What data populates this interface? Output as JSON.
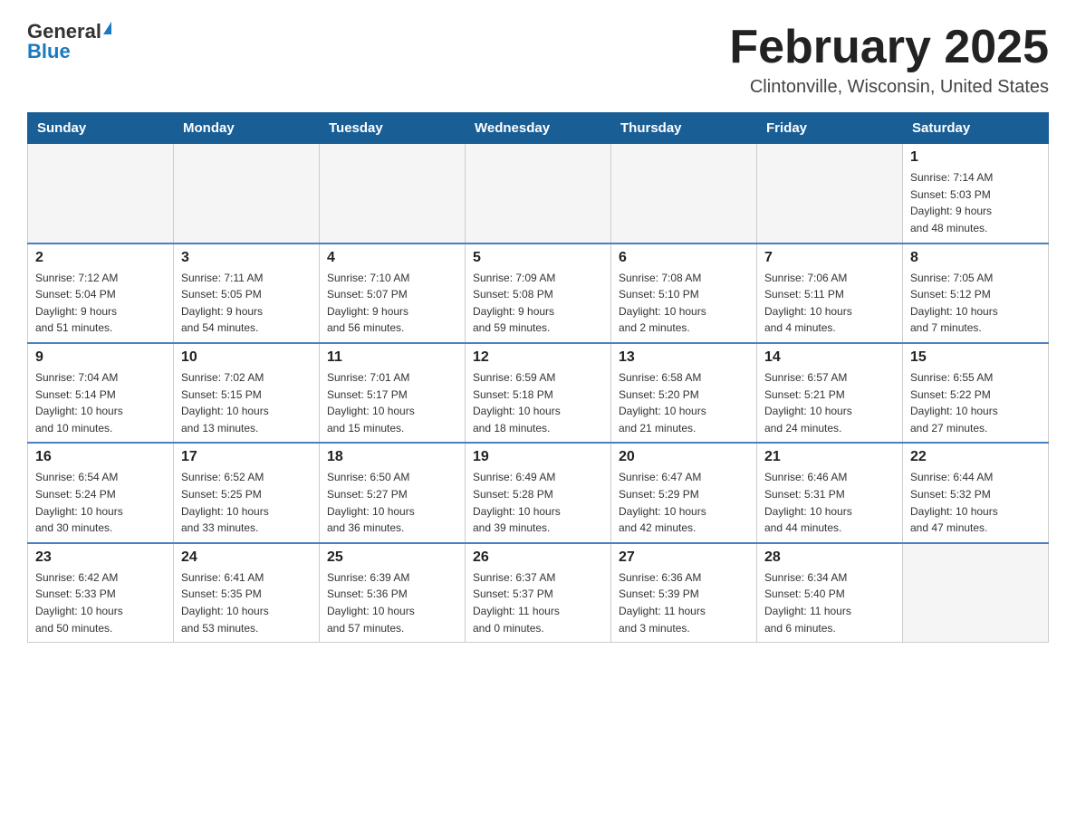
{
  "header": {
    "logo_general": "General",
    "logo_blue": "Blue",
    "title": "February 2025",
    "subtitle": "Clintonville, Wisconsin, United States"
  },
  "days_of_week": [
    "Sunday",
    "Monday",
    "Tuesday",
    "Wednesday",
    "Thursday",
    "Friday",
    "Saturday"
  ],
  "weeks": [
    [
      {
        "date": "",
        "info": ""
      },
      {
        "date": "",
        "info": ""
      },
      {
        "date": "",
        "info": ""
      },
      {
        "date": "",
        "info": ""
      },
      {
        "date": "",
        "info": ""
      },
      {
        "date": "",
        "info": ""
      },
      {
        "date": "1",
        "info": "Sunrise: 7:14 AM\nSunset: 5:03 PM\nDaylight: 9 hours\nand 48 minutes."
      }
    ],
    [
      {
        "date": "2",
        "info": "Sunrise: 7:12 AM\nSunset: 5:04 PM\nDaylight: 9 hours\nand 51 minutes."
      },
      {
        "date": "3",
        "info": "Sunrise: 7:11 AM\nSunset: 5:05 PM\nDaylight: 9 hours\nand 54 minutes."
      },
      {
        "date": "4",
        "info": "Sunrise: 7:10 AM\nSunset: 5:07 PM\nDaylight: 9 hours\nand 56 minutes."
      },
      {
        "date": "5",
        "info": "Sunrise: 7:09 AM\nSunset: 5:08 PM\nDaylight: 9 hours\nand 59 minutes."
      },
      {
        "date": "6",
        "info": "Sunrise: 7:08 AM\nSunset: 5:10 PM\nDaylight: 10 hours\nand 2 minutes."
      },
      {
        "date": "7",
        "info": "Sunrise: 7:06 AM\nSunset: 5:11 PM\nDaylight: 10 hours\nand 4 minutes."
      },
      {
        "date": "8",
        "info": "Sunrise: 7:05 AM\nSunset: 5:12 PM\nDaylight: 10 hours\nand 7 minutes."
      }
    ],
    [
      {
        "date": "9",
        "info": "Sunrise: 7:04 AM\nSunset: 5:14 PM\nDaylight: 10 hours\nand 10 minutes."
      },
      {
        "date": "10",
        "info": "Sunrise: 7:02 AM\nSunset: 5:15 PM\nDaylight: 10 hours\nand 13 minutes."
      },
      {
        "date": "11",
        "info": "Sunrise: 7:01 AM\nSunset: 5:17 PM\nDaylight: 10 hours\nand 15 minutes."
      },
      {
        "date": "12",
        "info": "Sunrise: 6:59 AM\nSunset: 5:18 PM\nDaylight: 10 hours\nand 18 minutes."
      },
      {
        "date": "13",
        "info": "Sunrise: 6:58 AM\nSunset: 5:20 PM\nDaylight: 10 hours\nand 21 minutes."
      },
      {
        "date": "14",
        "info": "Sunrise: 6:57 AM\nSunset: 5:21 PM\nDaylight: 10 hours\nand 24 minutes."
      },
      {
        "date": "15",
        "info": "Sunrise: 6:55 AM\nSunset: 5:22 PM\nDaylight: 10 hours\nand 27 minutes."
      }
    ],
    [
      {
        "date": "16",
        "info": "Sunrise: 6:54 AM\nSunset: 5:24 PM\nDaylight: 10 hours\nand 30 minutes."
      },
      {
        "date": "17",
        "info": "Sunrise: 6:52 AM\nSunset: 5:25 PM\nDaylight: 10 hours\nand 33 minutes."
      },
      {
        "date": "18",
        "info": "Sunrise: 6:50 AM\nSunset: 5:27 PM\nDaylight: 10 hours\nand 36 minutes."
      },
      {
        "date": "19",
        "info": "Sunrise: 6:49 AM\nSunset: 5:28 PM\nDaylight: 10 hours\nand 39 minutes."
      },
      {
        "date": "20",
        "info": "Sunrise: 6:47 AM\nSunset: 5:29 PM\nDaylight: 10 hours\nand 42 minutes."
      },
      {
        "date": "21",
        "info": "Sunrise: 6:46 AM\nSunset: 5:31 PM\nDaylight: 10 hours\nand 44 minutes."
      },
      {
        "date": "22",
        "info": "Sunrise: 6:44 AM\nSunset: 5:32 PM\nDaylight: 10 hours\nand 47 minutes."
      }
    ],
    [
      {
        "date": "23",
        "info": "Sunrise: 6:42 AM\nSunset: 5:33 PM\nDaylight: 10 hours\nand 50 minutes."
      },
      {
        "date": "24",
        "info": "Sunrise: 6:41 AM\nSunset: 5:35 PM\nDaylight: 10 hours\nand 53 minutes."
      },
      {
        "date": "25",
        "info": "Sunrise: 6:39 AM\nSunset: 5:36 PM\nDaylight: 10 hours\nand 57 minutes."
      },
      {
        "date": "26",
        "info": "Sunrise: 6:37 AM\nSunset: 5:37 PM\nDaylight: 11 hours\nand 0 minutes."
      },
      {
        "date": "27",
        "info": "Sunrise: 6:36 AM\nSunset: 5:39 PM\nDaylight: 11 hours\nand 3 minutes."
      },
      {
        "date": "28",
        "info": "Sunrise: 6:34 AM\nSunset: 5:40 PM\nDaylight: 11 hours\nand 6 minutes."
      },
      {
        "date": "",
        "info": ""
      }
    ]
  ]
}
